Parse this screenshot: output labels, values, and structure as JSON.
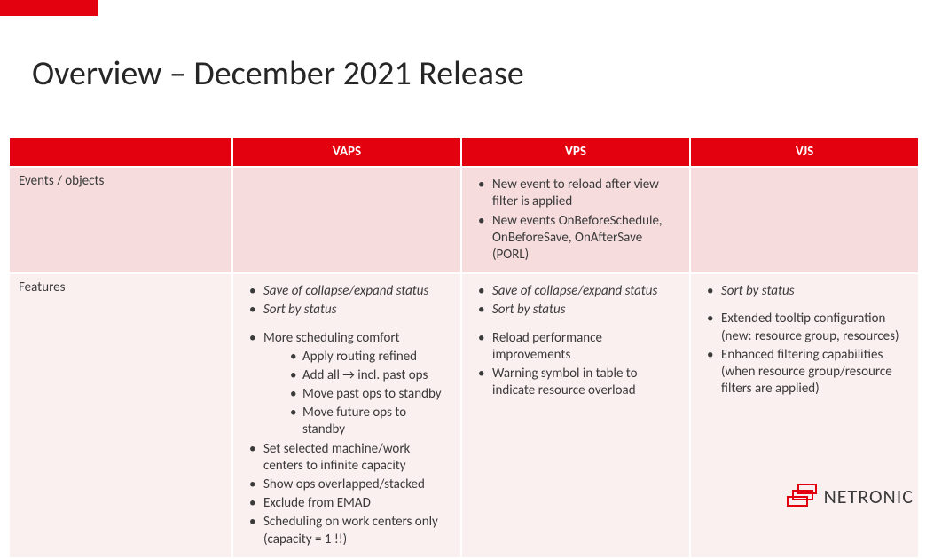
{
  "title": "Overview – December 2021 Release",
  "logo_text": "NETRONIC",
  "columns": {
    "c0": "",
    "c1": "VAPS",
    "c2": "VPS",
    "c3": "VJS"
  },
  "rows": {
    "events": {
      "label": "Events / objects",
      "vaps": [],
      "vps": [
        {
          "text": "New event to reload after view filter is applied"
        },
        {
          "text": "New events OnBeforeSchedule, OnBeforeSave, OnAfterSave (PORL)"
        }
      ],
      "vjs": []
    },
    "features": {
      "label": "Features",
      "vaps": [
        {
          "text": "Save of collapse/expand status",
          "italic": true
        },
        {
          "text": "Sort by status",
          "italic": true,
          "gap_after": true
        },
        {
          "text": "More scheduling comfort",
          "sub": [
            "Apply routing refined",
            "Add all → incl. past ops",
            "Move past ops to standby",
            "Move future ops to standby"
          ]
        },
        {
          "text": "Set selected machine/work centers to infinite capacity"
        },
        {
          "text": "Show ops overlapped/stacked"
        },
        {
          "text": "Exclude from EMAD"
        },
        {
          "text": "Scheduling on work centers only (capacity = 1 !!)"
        }
      ],
      "vps": [
        {
          "text": "Save of collapse/expand status",
          "italic": true
        },
        {
          "text": "Sort by status",
          "italic": true,
          "gap_after": true
        },
        {
          "text": "Reload performance improvements"
        },
        {
          "text": "Warning symbol in table to indicate resource overload"
        }
      ],
      "vjs": [
        {
          "text": "Sort by status",
          "italic": true,
          "gap_after": true
        },
        {
          "text": "Extended tooltip configuration (new: resource group, resources)"
        },
        {
          "text": "Enhanced filtering capabilities (when resource group/resource filters are applied)"
        }
      ]
    }
  }
}
